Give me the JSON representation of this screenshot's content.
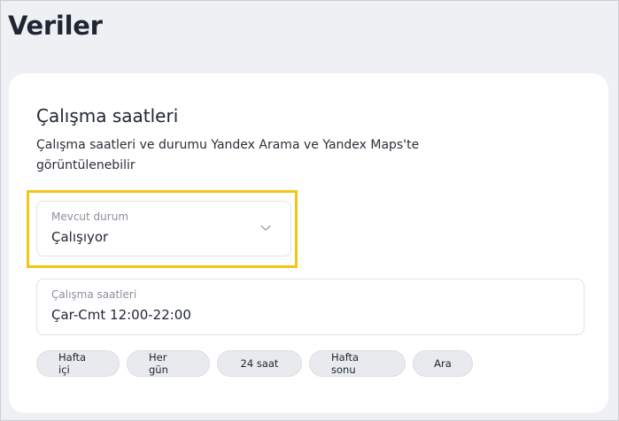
{
  "page": {
    "title": "Veriler"
  },
  "card": {
    "title": "Çalışma saatleri",
    "description": "Çalışma saatleri ve durumu Yandex Arama ve Yandex Maps'te görüntülenebilir"
  },
  "status_field": {
    "label": "Mevcut durum",
    "value": "Çalışıyor",
    "icon": "chevron-down-icon",
    "highlight_color": "#f4c514"
  },
  "hours_field": {
    "label": "Çalışma saatleri",
    "value": "Çar-Cmt 12:00-22:00"
  },
  "chips": [
    {
      "label": "Hafta içi"
    },
    {
      "label": "Her gün"
    },
    {
      "label": "24 saat"
    },
    {
      "label": "Hafta sonu"
    },
    {
      "label": "Ara"
    }
  ]
}
